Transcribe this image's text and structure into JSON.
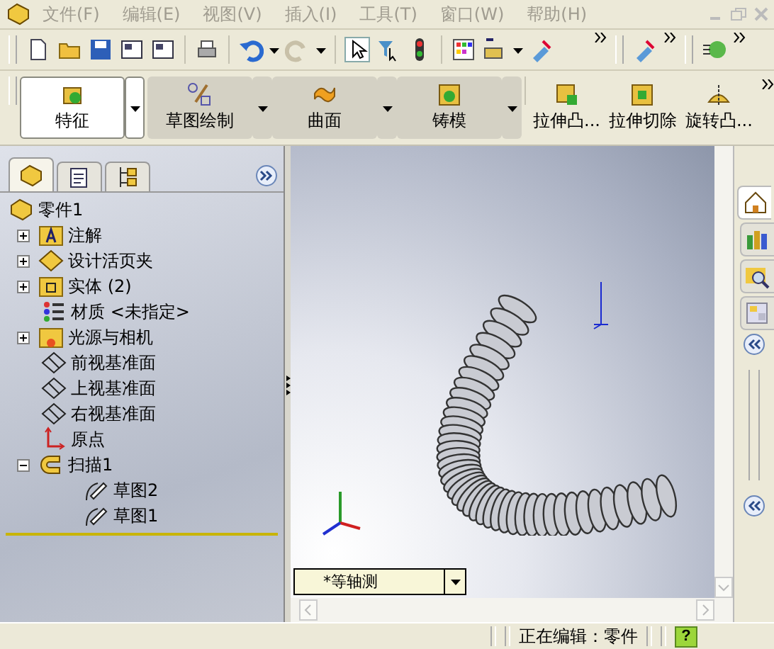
{
  "menu": [
    {
      "label": "文件(F)"
    },
    {
      "label": "编辑(E)"
    },
    {
      "label": "视图(V)"
    },
    {
      "label": "插入(I)"
    },
    {
      "label": "工具(T)"
    },
    {
      "label": "窗口(W)"
    },
    {
      "label": "帮助(H)"
    }
  ],
  "command_tabs": [
    {
      "label": "特征",
      "selected": true
    },
    {
      "label": "草图绘制",
      "selected": false
    },
    {
      "label": "曲面",
      "selected": false
    },
    {
      "label": "铸模",
      "selected": false
    }
  ],
  "command_buttons": [
    {
      "label": "拉伸凸...",
      "kind": "extrude"
    },
    {
      "label": "拉伸切除",
      "kind": "cut"
    },
    {
      "label": "旋转凸...",
      "kind": "revolve"
    }
  ],
  "panel_tabs": [
    {
      "kind": "tree",
      "selected": true
    },
    {
      "kind": "property",
      "selected": false
    },
    {
      "kind": "config",
      "selected": false
    }
  ],
  "tree": {
    "label": "零件1",
    "kind": "part",
    "children": [
      {
        "label": "注解",
        "kind": "annotation",
        "expanded": false
      },
      {
        "label": "设计活页夹",
        "kind": "binder",
        "expanded": false
      },
      {
        "label": "实体 (2)",
        "kind": "bodies",
        "expanded": false
      },
      {
        "label": "材质 <未指定>",
        "kind": "material"
      },
      {
        "label": "光源与相机",
        "kind": "lights",
        "expanded": false
      },
      {
        "label": "前视基准面",
        "kind": "plane"
      },
      {
        "label": "上视基准面",
        "kind": "plane"
      },
      {
        "label": "右视基准面",
        "kind": "plane"
      },
      {
        "label": "原点",
        "kind": "origin"
      },
      {
        "label": "扫描1",
        "kind": "sweep",
        "expanded": true,
        "children": [
          {
            "label": "草图2",
            "kind": "sketch"
          },
          {
            "label": "草图1",
            "kind": "sketch"
          }
        ]
      }
    ]
  },
  "view_selector": "*等轴测",
  "task_tabs": [
    {
      "kind": "home",
      "selected": true
    },
    {
      "kind": "library",
      "selected": false
    },
    {
      "kind": "explorer",
      "selected": false
    },
    {
      "kind": "palette",
      "selected": false
    }
  ],
  "status_bar": {
    "text": "正在编辑：零件",
    "help": "?"
  }
}
